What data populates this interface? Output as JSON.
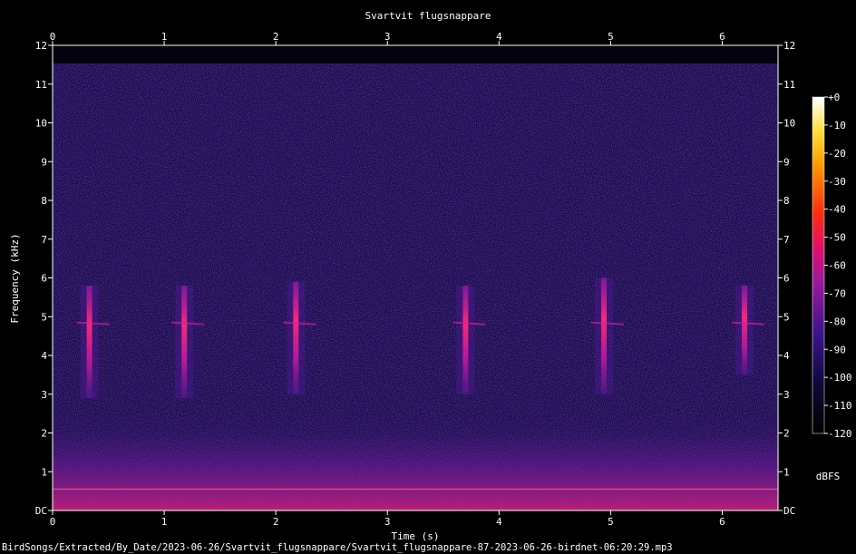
{
  "chart_data": {
    "type": "heatmap",
    "title": "Svartvit flugsnappare",
    "xlabel": "Time (s)",
    "ylabel": "Frequency (kHz)",
    "xlim": [
      0,
      6.5
    ],
    "ylim": [
      0,
      12
    ],
    "x_ticks": [
      "0",
      "1",
      "2",
      "3",
      "4",
      "5",
      "6"
    ],
    "y_ticks": [
      "DC",
      "1",
      "2",
      "3",
      "4",
      "5",
      "6",
      "7",
      "8",
      "9",
      "10",
      "11",
      "12"
    ],
    "colorbar": {
      "label": "dBFS",
      "range": [
        -120,
        0
      ],
      "ticks": [
        "+0",
        "-10",
        "-20",
        "-30",
        "-40",
        "-50",
        "-60",
        "-70",
        "-80",
        "-90",
        "-100",
        "-110",
        "-120"
      ]
    },
    "syllables": [
      {
        "t": 0.33,
        "f_low": 2.9,
        "f_high": 5.8,
        "dbfs": -62
      },
      {
        "t": 1.18,
        "f_low": 2.9,
        "f_high": 5.8,
        "dbfs": -64
      },
      {
        "t": 2.18,
        "f_low": 3.0,
        "f_high": 5.9,
        "dbfs": -60
      },
      {
        "t": 3.7,
        "f_low": 3.0,
        "f_high": 5.8,
        "dbfs": -63
      },
      {
        "t": 4.94,
        "f_low": 3.0,
        "f_high": 6.0,
        "dbfs": -64
      },
      {
        "t": 6.2,
        "f_low": 3.5,
        "f_high": 5.8,
        "dbfs": -66
      }
    ]
  },
  "footer": {
    "path": "BirdSongs/Extracted/By_Date/2023-06-26/Svartvit_flugsnappare/Svartvit_flugsnappare-87-2023-06-26-birdnet-06:20:29.mp3"
  }
}
